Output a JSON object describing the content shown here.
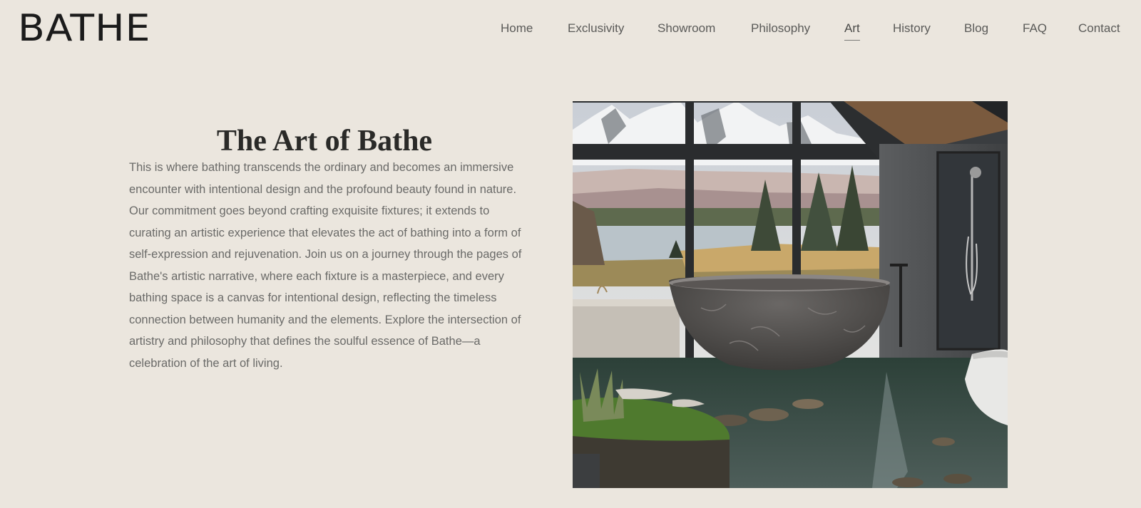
{
  "brand": {
    "logo": "BATHE"
  },
  "nav": {
    "items": [
      {
        "label": "Home"
      },
      {
        "label": "Exclusivity"
      },
      {
        "label": "Showroom"
      },
      {
        "label": "Philosophy"
      },
      {
        "label": "Art",
        "active": true
      },
      {
        "label": "History"
      },
      {
        "label": "Blog"
      },
      {
        "label": "FAQ"
      },
      {
        "label": "Contact"
      }
    ]
  },
  "main": {
    "title": "The Art of Bathe",
    "body": "This is where bathing transcends the ordinary and becomes an immersive encounter with intentional design and the profound beauty found in nature. Our commitment goes beyond crafting exquisite fixtures; it extends to curating an artistic experience that elevates the act of bathing into a form of self-expression and rejuvenation. Join us on a journey through the pages of Bathe's artistic narrative, where each fixture is a masterpiece, and every bathing space is a canvas for intentional design, reflecting the timeless connection between humanity and the elements. Explore the intersection of artistry and philosophy that defines the soulful essence of Bathe—a celebration of the art of living."
  },
  "colors": {
    "background": "#ebe6de",
    "text": "#6a6a68",
    "heading": "#2a2a28"
  }
}
